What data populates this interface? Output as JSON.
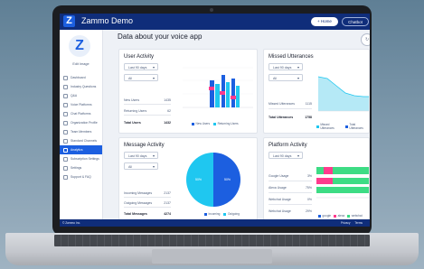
{
  "app": {
    "title": "Zammo Demo",
    "logo_letter": "Z",
    "home_label": "+ Home",
    "chatbot_label": "Chatbot"
  },
  "sidebar": {
    "edit_label": "Edit Image",
    "items": [
      {
        "label": "Dashboard",
        "active": false
      },
      {
        "label": "Industry Questions",
        "active": false
      },
      {
        "label": "Q&A",
        "active": false
      },
      {
        "label": "Voice Platforms",
        "active": false
      },
      {
        "label": "Chat Platforms",
        "active": false
      },
      {
        "label": "Organization Profile",
        "active": false
      },
      {
        "label": "Team Members",
        "active": false
      },
      {
        "label": "Standard Channels",
        "active": false
      },
      {
        "label": "Analytics",
        "active": true
      },
      {
        "label": "Subscription Settings",
        "active": false
      },
      {
        "label": "Settings",
        "active": false
      },
      {
        "label": "Support & FAQ",
        "active": false
      }
    ]
  },
  "page": {
    "title": "Data about your voice app"
  },
  "user_activity": {
    "title": "User Activity",
    "period": "Last 90 days",
    "filter": "All",
    "stats": [
      {
        "label": "New Users",
        "value": "1435"
      },
      {
        "label": "Returning Users",
        "value": "62"
      }
    ],
    "total": {
      "label": "Total Users",
      "value": "1432"
    },
    "legend": [
      "New Users",
      "Returning Users"
    ],
    "colors": {
      "new": "#1c5fe0",
      "returning": "#1fc7f0",
      "highlight": "#ff3b8d"
    }
  },
  "missed": {
    "title": "Missed Utterances",
    "period": "Last 90 days",
    "filter": "All",
    "stats": [
      {
        "label": "Missed Utterances",
        "value": "1115"
      }
    ],
    "total": {
      "label": "Total Utterances",
      "value": "1758"
    },
    "legend": [
      "Missed Utterances",
      "Total Utterances"
    ]
  },
  "message_activity": {
    "title": "Message Activity",
    "period": "Last 90 days",
    "filter": "All",
    "stats": [
      {
        "label": "Incoming Messages",
        "value": "2137"
      },
      {
        "label": "Outgoing Messages",
        "value": "2137"
      }
    ],
    "total": {
      "label": "Total Messages",
      "value": "4274"
    },
    "legend": [
      "Incoming",
      "Outgoing"
    ],
    "slices": [
      {
        "name": "Incoming",
        "value": 50,
        "label": "50%"
      },
      {
        "name": "Outgoing",
        "value": 50,
        "label": "50%"
      }
    ]
  },
  "platform_activity": {
    "title": "Platform Activity",
    "period": "Last 90 days",
    "stats": [
      {
        "label": "Google Usage",
        "value": "3%"
      },
      {
        "label": "Alexa Usage",
        "value": "75%"
      },
      {
        "label": "Webchat Usage",
        "value": "0%"
      },
      {
        "label": "Webchat Usage",
        "value": "29%"
      }
    ],
    "legend": [
      "google",
      "alexa",
      "webchat"
    ]
  },
  "footer": {
    "left": "© Zammo Inc.",
    "links": [
      "Privacy",
      "Terms"
    ]
  }
}
